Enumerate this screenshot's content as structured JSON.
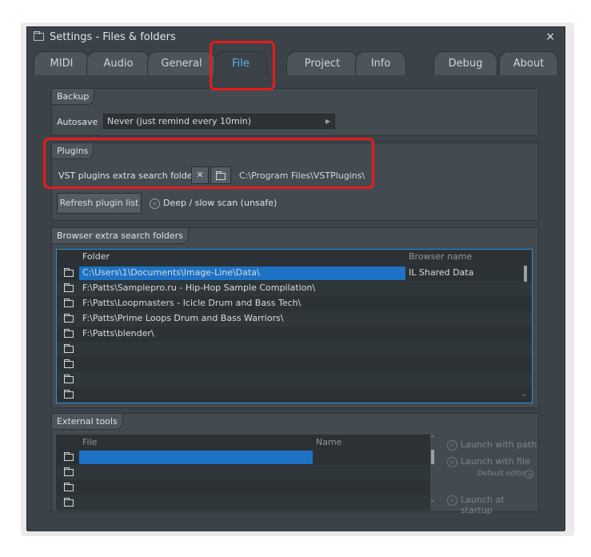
{
  "window": {
    "title": "Settings - Files & folders",
    "close_glyph": "×"
  },
  "tabs": [
    {
      "label": "MIDI"
    },
    {
      "label": "Audio"
    },
    {
      "label": "General"
    },
    {
      "label": "File"
    },
    {
      "label": "Project"
    },
    {
      "label": "Info"
    },
    {
      "label": "Debug"
    },
    {
      "label": "About"
    }
  ],
  "active_tab": "File",
  "backup": {
    "header": "Backup",
    "autosave_label": "Autosave",
    "autosave_value": "Never (just remind every 10min)"
  },
  "plugins": {
    "header": "Plugins",
    "vst_label": "VST plugins extra search folder",
    "clear_glyph": "✕",
    "vst_path": "C:\\Program Files\\VSTPlugins\\",
    "refresh_label": "Refresh plugin list",
    "deep_scan_label": "Deep / slow scan (unsafe)"
  },
  "browser": {
    "header": "Browser extra search folders",
    "col_folder": "Folder",
    "col_name": "Browser name",
    "rows": [
      {
        "folder": "C:\\Users\\1\\Documents\\Image-Line\\Data\\",
        "name": "IL Shared Data"
      },
      {
        "folder": "F:\\Patts\\Samplepro.ru - Hip-Hop Sample Compilation\\",
        "name": ""
      },
      {
        "folder": "F:\\Patts\\Loopmasters - Icicle Drum and Bass Tech\\",
        "name": ""
      },
      {
        "folder": "F:\\Patts\\Prime Loops Drum and Bass Warriors\\",
        "name": ""
      },
      {
        "folder": "F:\\Patts\\blender\\",
        "name": ""
      },
      {
        "folder": "",
        "name": ""
      },
      {
        "folder": "",
        "name": ""
      },
      {
        "folder": "",
        "name": ""
      }
    ]
  },
  "external": {
    "header": "External tools",
    "col_file": "File",
    "col_name": "Name",
    "launch_with_path": "Launch with path",
    "launch_with_file": "Launch with file",
    "default_editor": "Default editor",
    "launch_at_startup": "Launch at startup"
  },
  "colors": {
    "accent": "#2a8fde",
    "selection": "#1d72c6",
    "highlight_box": "#e81b1b",
    "active_tab_text": "#5fb3ea"
  }
}
